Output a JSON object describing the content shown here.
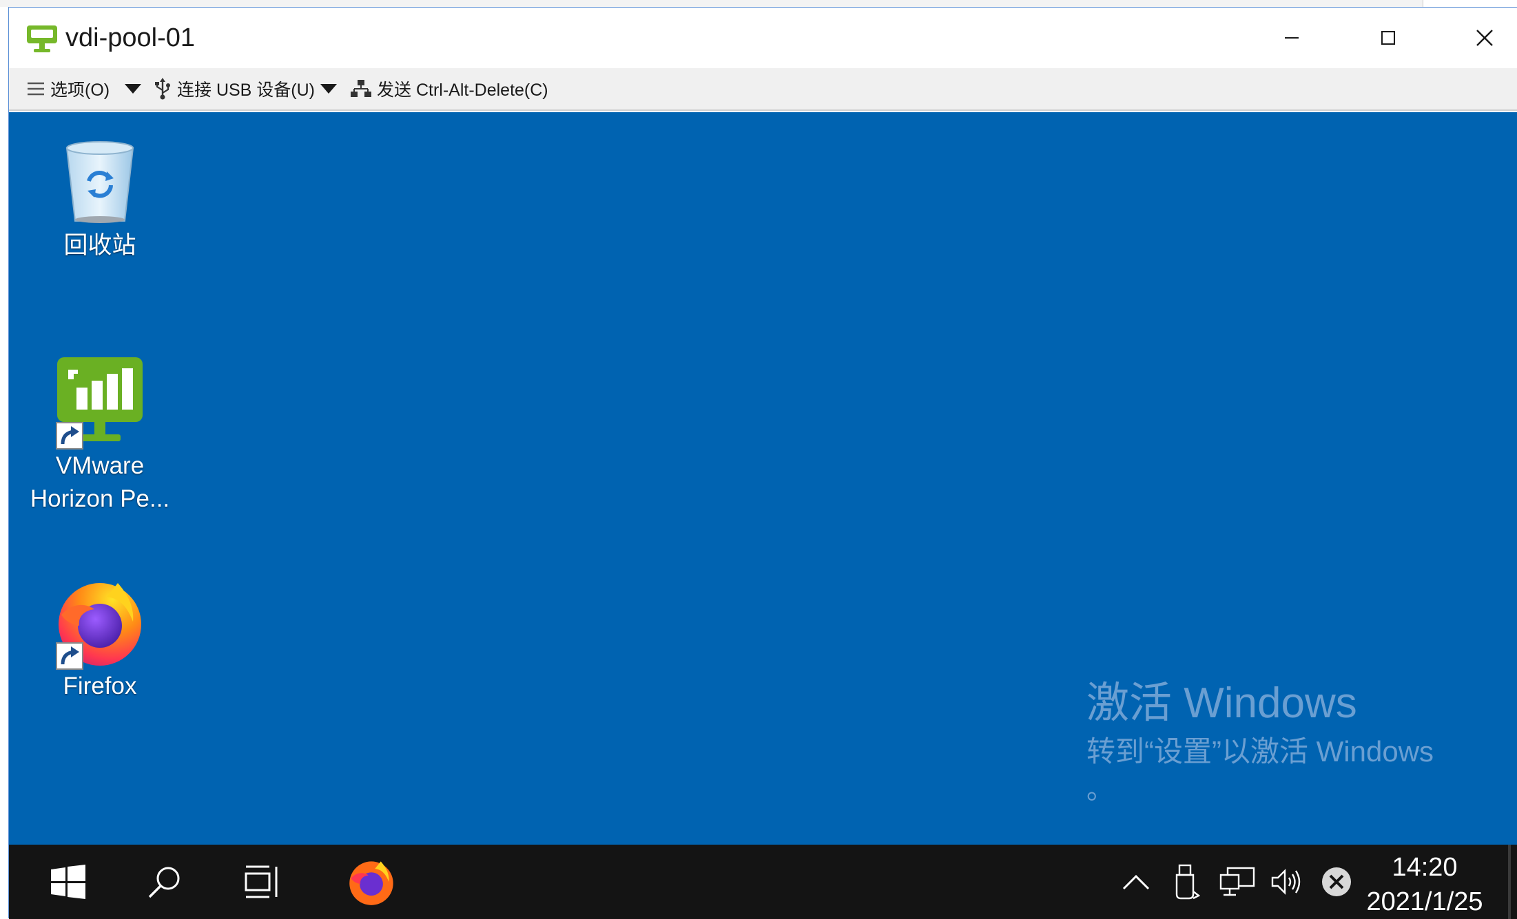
{
  "window": {
    "title": "vdi-pool-01"
  },
  "toolbar": {
    "options_label": "选项(O)",
    "usb_label": "连接 USB 设备(U)",
    "send_cad_label": "发送 Ctrl-Alt-Delete(C)"
  },
  "desktop": {
    "icons": [
      {
        "label": "回收站",
        "icon": "recycle-bin-icon"
      },
      {
        "label_line1": "VMware",
        "label_line2": "Horizon Pe...",
        "icon": "vmware-horizon-icon"
      },
      {
        "label": "Firefox",
        "icon": "firefox-icon"
      }
    ],
    "background_color": "#0063b1",
    "watermark": {
      "title": "激活 Windows",
      "subtitle": "转到“设置”以激活 Windows",
      "dot": "。"
    }
  },
  "taskbar": {
    "time": "14:20",
    "date": "2021/1/25",
    "background_color": "#141414"
  }
}
